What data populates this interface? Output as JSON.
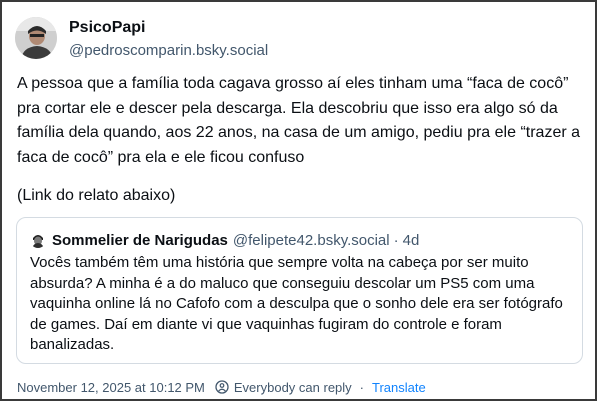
{
  "post": {
    "author": {
      "display_name": "PsicoPapi",
      "handle": "@pedroscomparin.bsky.social"
    },
    "text_paragraphs": [
      "A pessoa que a família toda cagava grosso aí eles tinham uma “faca de cocô” pra cortar ele e descer pela descarga. Ela descobriu que isso era algo só da família dela quando, aos 22 anos, na casa de um amigo, pediu pra ele “trazer a faca de cocô” pra ela e ele ficou confuso",
      "(Link do relato abaixo)"
    ],
    "quote": {
      "author_name": "Sommelier de Narigudas",
      "handle": "@felipete42.bsky.social",
      "separator": "·",
      "time": "4d",
      "text": "Vocês também têm uma história que sempre volta na cabeça por ser muito absurda? A minha é a do maluco que conseguiu descolar um PS5 com uma vaquinha online lá no Cafofo com a desculpa que o sonho dele era ser fotógrafo de games. Daí em diante vi que vaquinhas fugiram do controle e foram banalizadas."
    },
    "footer": {
      "timestamp": "November 12, 2025 at 10:12 PM",
      "separator": "·",
      "reply_setting": "Everybody can reply",
      "translate_label": "Translate"
    }
  },
  "colors": {
    "text_primary": "#0b0f14",
    "text_secondary": "#42576c",
    "link": "#1083fe",
    "border": "#d4dbe2"
  },
  "icons": {
    "avatar": "profile-photo",
    "quote_avatar": "profile-photo",
    "reply_setting": "reply-audience-icon"
  }
}
